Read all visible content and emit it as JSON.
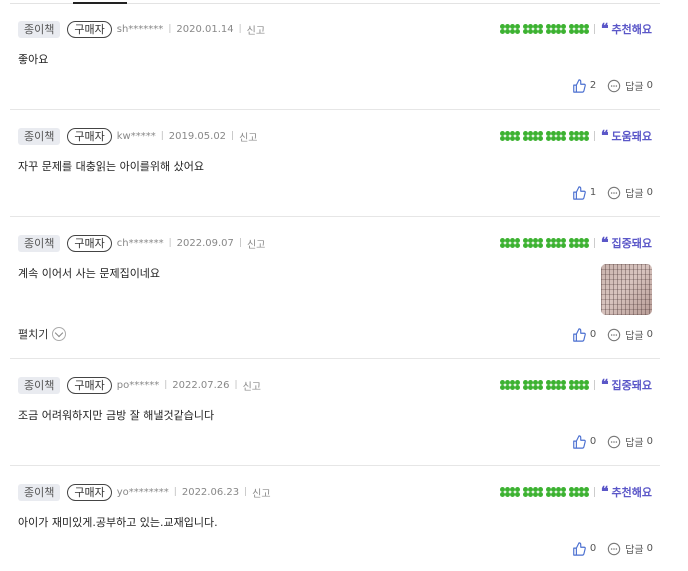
{
  "reviews": [
    {
      "format": "종이책",
      "buyer_badge": "구매자",
      "user": "sh*******",
      "date": "2020.01.14",
      "report": "신고",
      "tag": "추천해요",
      "content": "좋아요",
      "likes": "2",
      "reply_label": "답글",
      "reply_count": "0",
      "has_image": false
    },
    {
      "format": "종이책",
      "buyer_badge": "구매자",
      "user": "kw*****",
      "date": "2019.05.02",
      "report": "신고",
      "tag": "도움돼요",
      "content": "자꾸 문제를 대충읽는 아이를위해 샀어요",
      "likes": "1",
      "reply_label": "답글",
      "reply_count": "0",
      "has_image": false
    },
    {
      "format": "종이책",
      "buyer_badge": "구매자",
      "user": "ch*******",
      "date": "2022.09.07",
      "report": "신고",
      "tag": "집중돼요",
      "content": "계속 이어서 사는 문제집이네요",
      "expand_label": "펼치기",
      "likes": "0",
      "reply_label": "답글",
      "reply_count": "0",
      "has_image": true
    },
    {
      "format": "종이책",
      "buyer_badge": "구매자",
      "user": "po******",
      "date": "2022.07.26",
      "report": "신고",
      "tag": "집중돼요",
      "content": "조금 어려워하지만 금방 잘 해낼것같습니다",
      "likes": "0",
      "reply_label": "답글",
      "reply_count": "0",
      "has_image": false
    },
    {
      "format": "종이책",
      "buyer_badge": "구매자",
      "user": "yo********",
      "date": "2022.06.23",
      "report": "신고",
      "tag": "추천해요",
      "content": "아이가 재미있게.공부하고 있는.교재입니다.",
      "likes": "0",
      "reply_label": "답글",
      "reply_count": "0",
      "has_image": false
    }
  ],
  "rating_icon": "clover-icon",
  "rating_value": 4,
  "colors": {
    "clover": "#3db232",
    "tag": "#5b57c8"
  }
}
